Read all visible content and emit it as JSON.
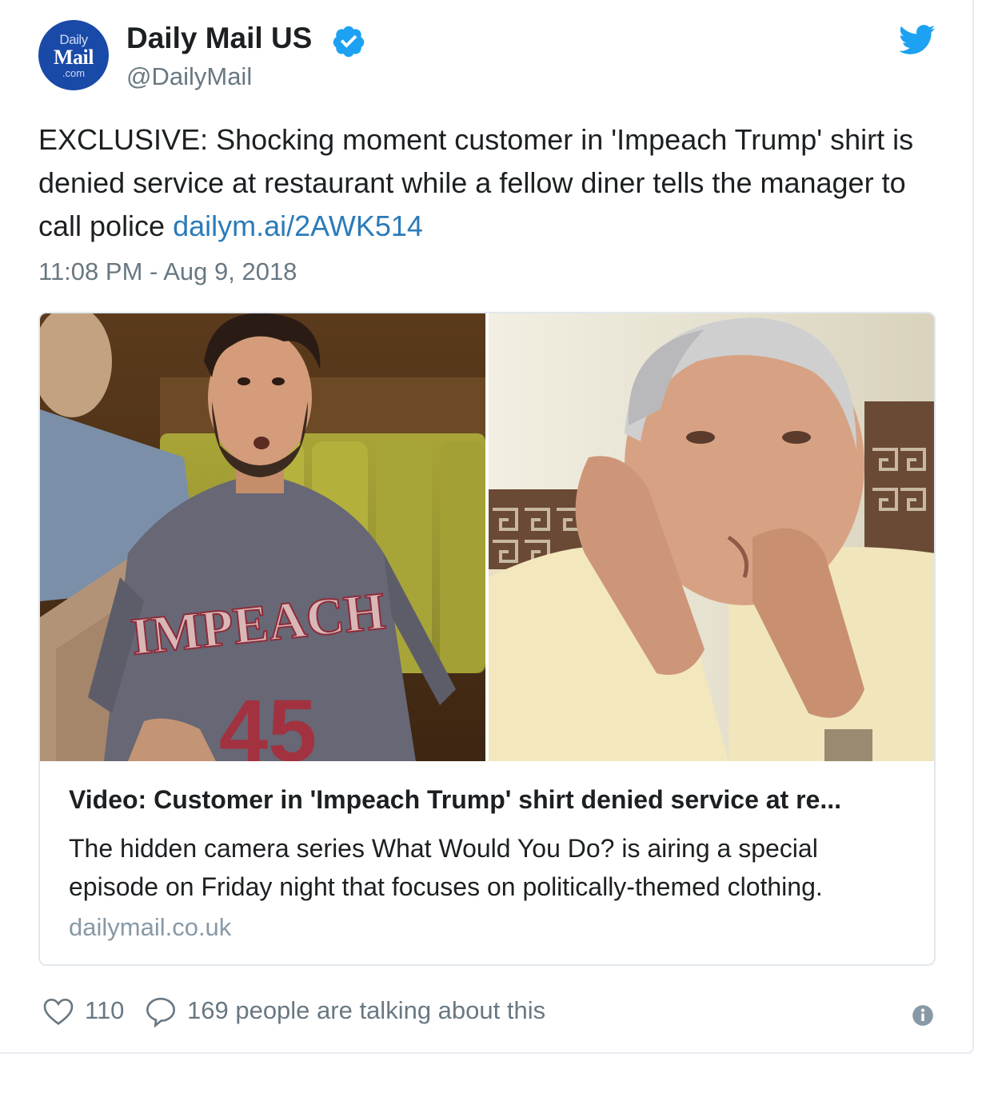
{
  "account": {
    "avatar_line1": "Daily",
    "avatar_line2": "Mail",
    "avatar_line3": ".com",
    "display_name": "Daily Mail US",
    "handle": "@DailyMail",
    "verified_icon": "verified-badge-icon",
    "platform_icon": "twitter-bird-icon"
  },
  "tweet": {
    "text": "EXCLUSIVE: Shocking moment customer in 'Impeach Trump' shirt is denied service at restaurant while a fellow diner tells the manager to call police ",
    "link": "dailym.ai/2AWK514",
    "timestamp": "11:08 PM - Aug 9, 2018"
  },
  "link_card": {
    "shirt_text": "IMPEACH",
    "shirt_number": "45",
    "title": "Video: Customer in 'Impeach Trump' shirt denied service at re...",
    "description": "The hidden camera series What Would You Do? is airing a special episode on Friday night that focuses on politically-themed clothing.",
    "domain": "dailymail.co.uk"
  },
  "actions": {
    "likes": "110",
    "talking": "169 people are talking about this",
    "like_icon": "heart-icon",
    "reply_icon": "speech-bubble-icon",
    "info_icon": "info-icon"
  },
  "colors": {
    "link": "#2b7bb9",
    "verified": "#1da1f2",
    "muted": "#697882",
    "avatar_bg": "#1a4aa8"
  }
}
